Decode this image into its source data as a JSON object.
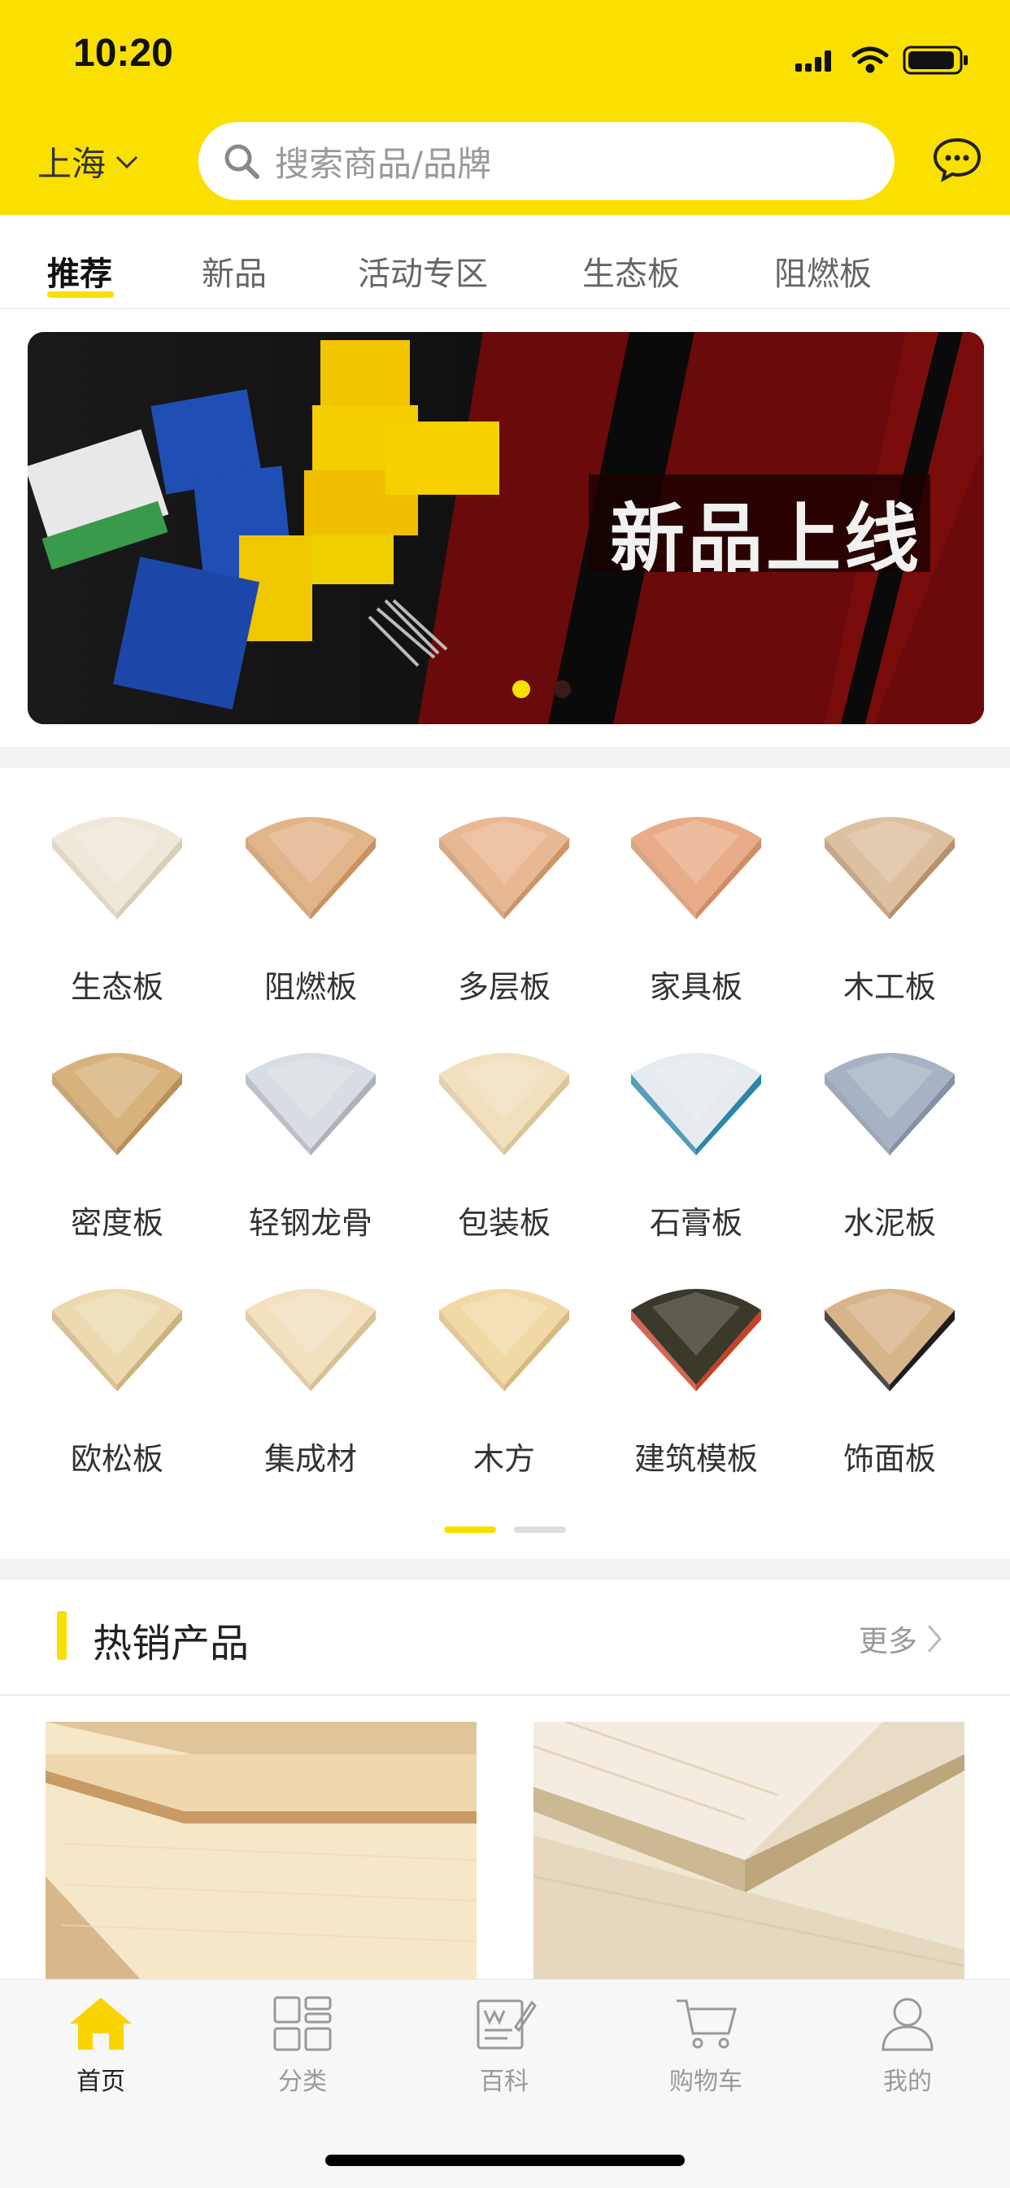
{
  "status": {
    "time": "10:20"
  },
  "header": {
    "city": "上海",
    "search_placeholder": "搜索商品/品牌",
    "message_icon": "chat-bubble-icon",
    "accent_color": "#fae000"
  },
  "tabs": [
    {
      "label": "推荐",
      "active": true
    },
    {
      "label": "新品"
    },
    {
      "label": "活动专区"
    },
    {
      "label": "生态板"
    },
    {
      "label": "阻燃板"
    }
  ],
  "banner": {
    "title": "新品上线",
    "active_dot": 1,
    "dots": 2
  },
  "categories": [
    {
      "label": "生态板"
    },
    {
      "label": "阻燃板"
    },
    {
      "label": "多层板"
    },
    {
      "label": "家具板"
    },
    {
      "label": "木工板"
    },
    {
      "label": "密度板"
    },
    {
      "label": "轻钢龙骨"
    },
    {
      "label": "包装板"
    },
    {
      "label": "石膏板"
    },
    {
      "label": "水泥板"
    },
    {
      "label": "欧松板"
    },
    {
      "label": "集成材"
    },
    {
      "label": "木方"
    },
    {
      "label": "建筑模板"
    },
    {
      "label": "饰面板"
    }
  ],
  "categories_pager": {
    "pages": 2,
    "active": 1
  },
  "hot": {
    "title": "热销产品",
    "more": "更多"
  },
  "bottom_nav": [
    {
      "label": "首页",
      "icon": "home-icon",
      "active": true
    },
    {
      "label": "分类",
      "icon": "grid-icon"
    },
    {
      "label": "百科",
      "icon": "encyclopedia-icon"
    },
    {
      "label": "购物车",
      "icon": "cart-icon"
    },
    {
      "label": "我的",
      "icon": "user-icon"
    }
  ]
}
